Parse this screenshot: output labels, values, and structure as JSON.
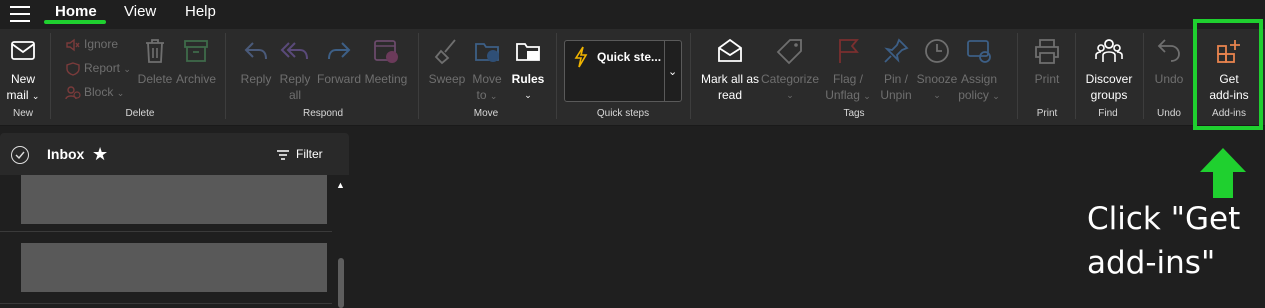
{
  "menu": {
    "tabs": [
      {
        "label": "Home",
        "active": true
      },
      {
        "label": "View"
      },
      {
        "label": "Help"
      }
    ]
  },
  "ribbon": {
    "new": {
      "new_mail_line1": "New",
      "new_mail_line2": "mail",
      "group": "New"
    },
    "delete": {
      "ignore": "Ignore",
      "report": "Report",
      "block": "Block",
      "delete": "Delete",
      "archive": "Archive",
      "group": "Delete"
    },
    "respond": {
      "reply": "Reply",
      "reply_all_line1": "Reply",
      "reply_all_line2": "all",
      "forward": "Forward",
      "meeting": "Meeting",
      "group": "Respond"
    },
    "move": {
      "sweep": "Sweep",
      "move_to_line1": "Move",
      "move_to_line2": "to",
      "rules": "Rules",
      "group": "Move"
    },
    "quick_steps": {
      "label": "Quick ste...",
      "group": "Quick steps"
    },
    "tags": {
      "mark_all_line1": "Mark all as",
      "mark_all_line2": "read",
      "categorize": "Categorize",
      "flag_line1": "Flag /",
      "flag_line2": "Unflag",
      "pin_line1": "Pin /",
      "pin_line2": "Unpin",
      "snooze": "Snooze",
      "assign_line1": "Assign",
      "assign_line2": "policy",
      "group": "Tags"
    },
    "print": {
      "label": "Print",
      "group": "Print"
    },
    "find": {
      "line1": "Discover",
      "line2": "groups",
      "group": "Find"
    },
    "undo": {
      "label": "Undo",
      "group": "Undo"
    },
    "addins": {
      "line1": "Get",
      "line2": "add-ins",
      "group": "Add-ins"
    }
  },
  "inbox": {
    "title": "Inbox",
    "filter": "Filter"
  },
  "annotation": {
    "line1": "Click \"Get",
    "line2": "add-ins\""
  },
  "colors": {
    "highlight": "#1fd02f",
    "accent_orange": "#e8834e",
    "ribbon_bg": "#2b2b2b"
  }
}
